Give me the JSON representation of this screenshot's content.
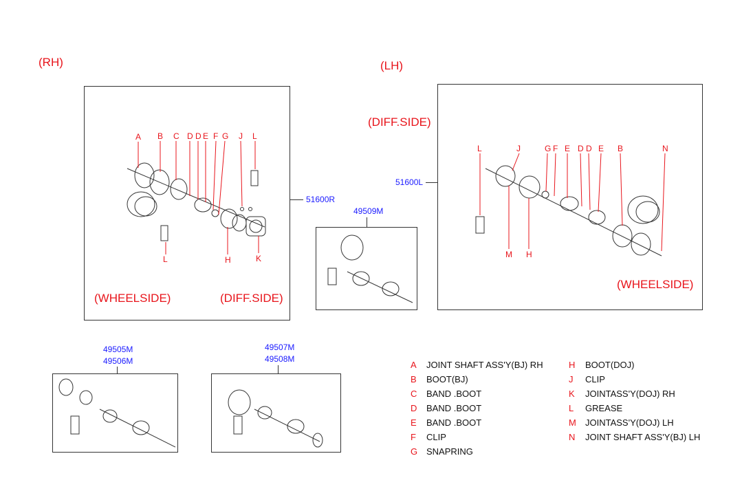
{
  "side_labels": {
    "rh": "(RH)",
    "lh": "(LH)"
  },
  "rh_box": {
    "wheelside": "(WHEELSIDE)",
    "diffside": "(DIFF.SIDE)",
    "part_no": "51600R",
    "letters_top": [
      "A",
      "B",
      "C",
      "D",
      "D",
      "E",
      "F",
      "G",
      "J",
      "L"
    ],
    "letters_bottom": [
      "L",
      "H",
      "K"
    ]
  },
  "lh_box": {
    "wheelside": "(WHEELSIDE)",
    "diffside": "(DIFF.SIDE)",
    "part_no": "51600L",
    "letters_top": [
      "L",
      "J",
      "G",
      "F",
      "E",
      "D",
      "D",
      "E",
      "B",
      "N"
    ],
    "letters_bottom": [
      "M",
      "H"
    ]
  },
  "kit_49509": {
    "part_no": "49509M"
  },
  "kit_49505": {
    "part_nos": [
      "49505M",
      "49506M"
    ]
  },
  "kit_49507": {
    "part_nos": [
      "49507M",
      "49508M"
    ]
  },
  "legend": [
    {
      "letter": "A",
      "text": "JOINT SHAFT  ASS'Y(BJ) RH"
    },
    {
      "letter": "B",
      "text": "BOOT(BJ)"
    },
    {
      "letter": "C",
      "text": "BAND .BOOT"
    },
    {
      "letter": "D",
      "text": "BAND .BOOT"
    },
    {
      "letter": "E",
      "text": "BAND .BOOT"
    },
    {
      "letter": "F",
      "text": "CLIP"
    },
    {
      "letter": "G",
      "text": "SNAPRING"
    },
    {
      "letter": "H",
      "text": "BOOT(DOJ)"
    },
    {
      "letter": "J",
      "text": "CLIP"
    },
    {
      "letter": "K",
      "text": "JOINTASS'Y(DOJ) RH"
    },
    {
      "letter": "L",
      "text": "GREASE"
    },
    {
      "letter": "M",
      "text": "JOINTASS'Y(DOJ) LH"
    },
    {
      "letter": "N",
      "text": "JOINT SHAFT  ASS'Y(BJ) LH"
    }
  ],
  "colors": {
    "callout": "#e8141b",
    "part_no": "#1a1aff"
  }
}
